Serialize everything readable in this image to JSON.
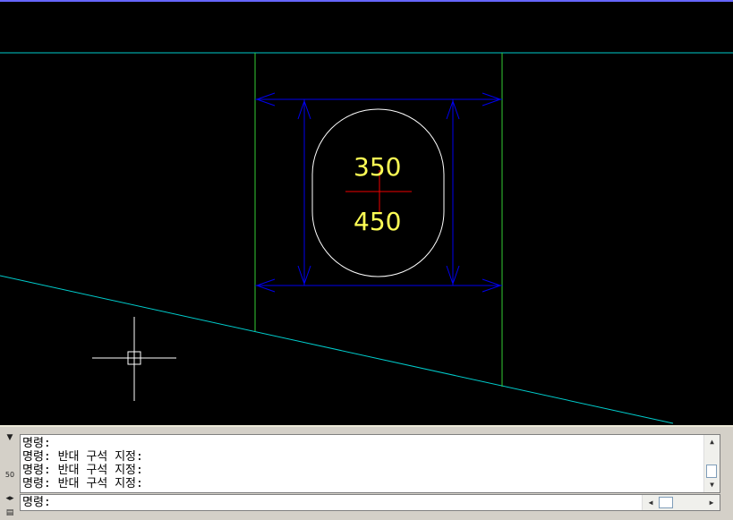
{
  "drawing": {
    "dimension_top": "350",
    "dimension_bottom": "450",
    "colors": {
      "background": "#000000",
      "wall_lines": "#33cc33",
      "cyan_lines": "#00cccc",
      "dimension_lines": "#0000ee",
      "outline": "#ffffff",
      "dimension_text": "#ffff55",
      "center_mark": "#ee0000",
      "crosshair": "#ffffff"
    }
  },
  "command_panel": {
    "history": [
      "명령:",
      "명령: 반대 구석 지정:",
      "명령: 반대 구석 지정:",
      "명령: 반대 구석 지정:"
    ],
    "prompt": "명령:",
    "input_value": "",
    "gutter_label": "50",
    "icons": {
      "pin": "pin-icon",
      "properties": "properties-icon",
      "scroll_up": "scroll-up-icon",
      "scroll_down": "scroll-down-icon",
      "scroll_left": "scroll-left-icon",
      "scroll_right": "scroll-right-icon"
    }
  }
}
